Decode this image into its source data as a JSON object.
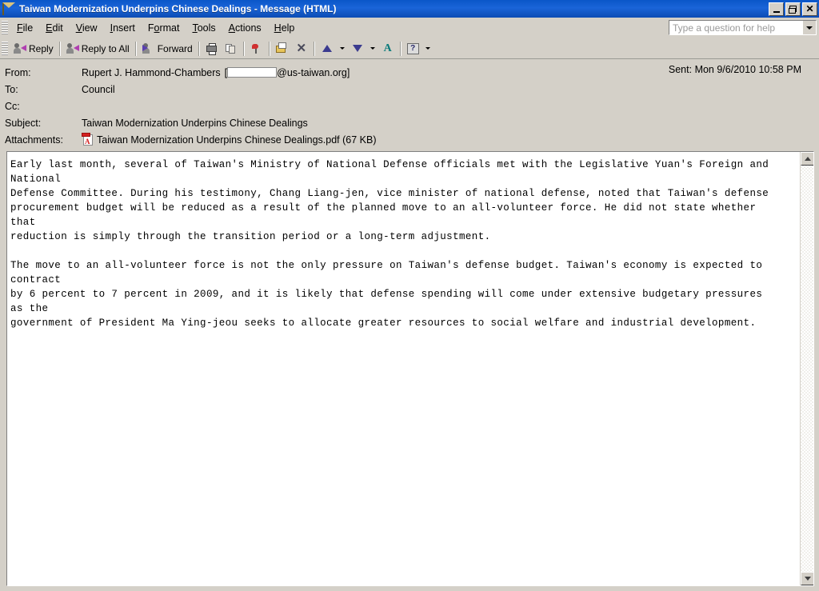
{
  "window": {
    "title": "Taiwan Modernization Underpins Chinese Dealings - Message (HTML)",
    "icon": "envelope-icon",
    "controls": {
      "minimize": "minimize-button",
      "restore": "restore-button",
      "close": "close-button"
    }
  },
  "menu": {
    "items": [
      {
        "label": "File",
        "accel": "F"
      },
      {
        "label": "Edit",
        "accel": "E"
      },
      {
        "label": "View",
        "accel": "V"
      },
      {
        "label": "Insert",
        "accel": "I"
      },
      {
        "label": "Format",
        "accel": "o"
      },
      {
        "label": "Tools",
        "accel": "T"
      },
      {
        "label": "Actions",
        "accel": "A"
      },
      {
        "label": "Help",
        "accel": "H"
      }
    ],
    "help_box": {
      "value": "",
      "placeholder": "Type a question for help"
    }
  },
  "toolbar": {
    "reply_label": "Reply",
    "reply_all_label": "Reply to All",
    "forward_label": "Forward",
    "print_title": "Print",
    "copy_title": "Copy",
    "flag_title": "Follow Up",
    "move_title": "Move to Folder",
    "delete_title": "Delete",
    "previous_title": "Previous Item",
    "next_title": "Next Item",
    "rules_title": "Rules",
    "help_title": "Microsoft Outlook Help",
    "help_glyph": "?",
    "delete_glyph": "✕",
    "rules_glyph": "A"
  },
  "headers": {
    "from_label": "From:",
    "from_name": "Rupert J. Hammond-Chambers",
    "from_bracket_open": "[",
    "from_domain": "@us-taiwan.org]",
    "to_label": "To:",
    "to_value": "Council",
    "cc_label": "Cc:",
    "cc_value": "",
    "subject_label": "Subject:",
    "subject_value": "Taiwan Modernization Underpins Chinese Dealings",
    "attachments_label": "Attachments:",
    "attachment_name": "Taiwan Modernization Underpins Chinese Dealings.pdf (67 KB)",
    "sent_label": "Sent:",
    "sent_value": "Mon 9/6/2010 10:58 PM"
  },
  "message": {
    "body": "Early last month, several of Taiwan's Ministry of National Defense officials met with the Legislative Yuan's Foreign and\nNational\nDefense Committee. During his testimony, Chang Liang-jen, vice minister of national defense, noted that Taiwan's defense\nprocurement budget will be reduced as a result of the planned move to an all-volunteer force. He did not state whether\nthat\nreduction is simply through the transition period or a long-term adjustment.\n\nThe move to an all-volunteer force is not the only pressure on Taiwan's defense budget. Taiwan's economy is expected to\ncontract\nby 6 percent to 7 percent in 2009, and it is likely that defense spending will come under extensive budgetary pressures\nas the\ngovernment of President Ma Ying-jeou seeks to allocate greater resources to social welfare and industrial development."
  },
  "colors": {
    "titlebar": "#0c4cb4",
    "chrome": "#d4d0c8",
    "body_background": "#ffffff",
    "accent_pdf": "#d42020"
  }
}
